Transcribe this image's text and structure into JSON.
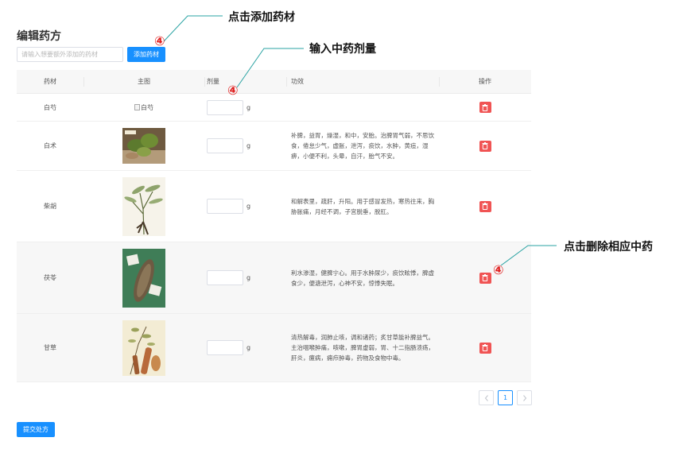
{
  "page": {
    "title": "编辑药方"
  },
  "toolbar": {
    "search_placeholder": "请输入想要额外添加的药材",
    "add_label": "添加药材"
  },
  "table": {
    "headers": [
      "药材",
      "主图",
      "剂量",
      "功效",
      "操作"
    ],
    "unit": "g",
    "rows": [
      {
        "name": "白芍",
        "image_alt": "白芍",
        "efficacy": ""
      },
      {
        "name": "白术",
        "image_alt": "白术",
        "efficacy": "补脾，益胃，燥湿，和中，安胎。治脾胃气弱，不思饮食，倦怠少气，虚胀，泄泻，痰饮，水肿，黄疸，湿痹，小便不利，头晕，自汗，胎气不安。"
      },
      {
        "name": "柴胡",
        "image_alt": "柴胡",
        "efficacy": "和解表里，疏肝，升阳。用于感冒发热，寒热往来，胸胁胀痛，月经不调，子宫脱垂，脱肛。"
      },
      {
        "name": "茯苓",
        "image_alt": "茯苓",
        "efficacy": "利水渗湿，健脾宁心。用于水肿尿少，痰饮眩悸，脾虚食少，便溏泄泻，心神不安，惊悸失眠。"
      },
      {
        "name": "甘草",
        "image_alt": "甘草",
        "efficacy": "清热解毒，润肺止咳，调和诸药；炙甘草能补脾益气。主治咽喉肿痛，咳嗽，脾胃虚弱，胃、十二指肠溃疡，肝炎，癔病，痈疖肿毒，药物及食物中毒。"
      }
    ]
  },
  "pagination": {
    "current": "1",
    "prev_icon": "chevron-left-icon",
    "next_icon": "chevron-right-icon"
  },
  "footer": {
    "submit_label": "提交处方"
  },
  "annotations": {
    "add_note": "点击添加药材",
    "dose_note": "输入中药剂量",
    "delete_note": "点击删除相应中药",
    "marker": "④"
  },
  "colors": {
    "primary": "#1890ff",
    "danger": "#f05454",
    "marker": "#e02020",
    "leader_line": "#2aa3a3"
  }
}
